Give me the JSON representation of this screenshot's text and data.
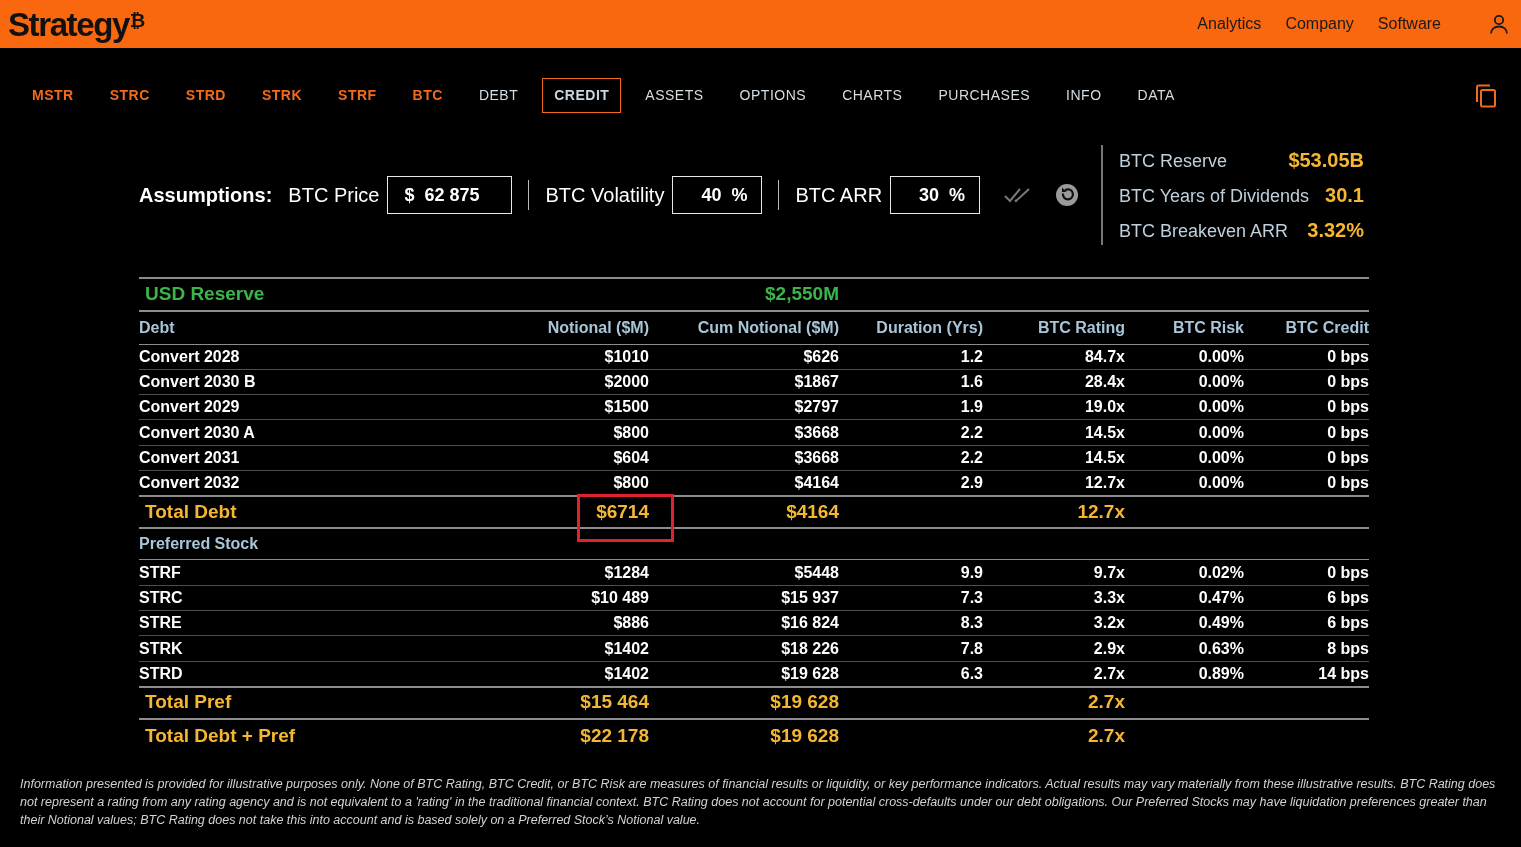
{
  "header": {
    "logo": "Strategy",
    "logo_mark": "₿",
    "links": [
      "Analytics",
      "Company",
      "Software"
    ]
  },
  "tabs": [
    {
      "label": "MSTR",
      "kind": "ticker",
      "selected": false
    },
    {
      "label": "STRC",
      "kind": "ticker",
      "selected": false
    },
    {
      "label": "STRD",
      "kind": "ticker",
      "selected": false
    },
    {
      "label": "STRK",
      "kind": "ticker",
      "selected": false
    },
    {
      "label": "STRF",
      "kind": "ticker",
      "selected": false
    },
    {
      "label": "BTC",
      "kind": "ticker",
      "selected": false
    },
    {
      "label": "DEBT",
      "kind": "page",
      "selected": false
    },
    {
      "label": "CREDIT",
      "kind": "page",
      "selected": true
    },
    {
      "label": "ASSETS",
      "kind": "page",
      "selected": false
    },
    {
      "label": "OPTIONS",
      "kind": "page",
      "selected": false
    },
    {
      "label": "CHARTS",
      "kind": "page",
      "selected": false
    },
    {
      "label": "PURCHASES",
      "kind": "page",
      "selected": false
    },
    {
      "label": "INFO",
      "kind": "page",
      "selected": false
    },
    {
      "label": "DATA",
      "kind": "page",
      "selected": false
    }
  ],
  "assumptions": {
    "title": "Assumptions:",
    "inputs": [
      {
        "label": "BTC Price",
        "prefix": "$",
        "value": "62 875"
      },
      {
        "label": "BTC Volatility",
        "value": "40",
        "suffix": "%"
      },
      {
        "label": "BTC ARR",
        "value": "30",
        "suffix": "%"
      }
    ]
  },
  "metrics": [
    {
      "label": "BTC Reserve",
      "value": "$53.05B"
    },
    {
      "label": "BTC Years of Dividends",
      "value": "30.1"
    },
    {
      "label": "BTC Breakeven ARR",
      "value": "3.32%"
    }
  ],
  "table": {
    "reserve": {
      "label": "USD Reserve",
      "cum_notional": "$2,550M"
    },
    "columns": [
      "Debt",
      "Notional ($M)",
      "Cum Notional ($M)",
      "Duration (Yrs)",
      "BTC Rating",
      "BTC Risk",
      "BTC Credit"
    ],
    "rows": [
      {
        "kind": "item",
        "cells": [
          "Convert 2028",
          "$1010",
          "$626",
          "1.2",
          "84.7x",
          "0.00%",
          "0 bps"
        ]
      },
      {
        "kind": "item",
        "cells": [
          "Convert 2030 B",
          "$2000",
          "$1867",
          "1.6",
          "28.4x",
          "0.00%",
          "0 bps"
        ]
      },
      {
        "kind": "item",
        "cells": [
          "Convert 2029",
          "$1500",
          "$2797",
          "1.9",
          "19.0x",
          "0.00%",
          "0 bps"
        ]
      },
      {
        "kind": "item",
        "cells": [
          "Convert 2030 A",
          "$800",
          "$3668",
          "2.2",
          "14.5x",
          "0.00%",
          "0 bps"
        ]
      },
      {
        "kind": "item",
        "cells": [
          "Convert 2031",
          "$604",
          "$3668",
          "2.2",
          "14.5x",
          "0.00%",
          "0 bps"
        ]
      },
      {
        "kind": "item",
        "cells": [
          "Convert 2032",
          "$800",
          "$4164",
          "2.9",
          "12.7x",
          "0.00%",
          "0 bps"
        ]
      },
      {
        "kind": "total",
        "label": "Total Debt",
        "notional": "$6714",
        "cum_notional": "$4164",
        "rating": "12.7x",
        "highlighted": true
      },
      {
        "kind": "section",
        "label": "Preferred Stock"
      },
      {
        "kind": "item",
        "cells": [
          "STRF",
          "$1284",
          "$5448",
          "9.9",
          "9.7x",
          "0.02%",
          "0 bps"
        ]
      },
      {
        "kind": "item",
        "cells": [
          "STRC",
          "$10 489",
          "$15 937",
          "7.3",
          "3.3x",
          "0.47%",
          "6 bps"
        ]
      },
      {
        "kind": "item",
        "cells": [
          "STRE",
          "$886",
          "$16 824",
          "8.3",
          "3.2x",
          "0.49%",
          "6 bps"
        ]
      },
      {
        "kind": "item",
        "cells": [
          "STRK",
          "$1402",
          "$18 226",
          "7.8",
          "2.9x",
          "0.63%",
          "8 bps"
        ]
      },
      {
        "kind": "item",
        "cells": [
          "STRD",
          "$1402",
          "$19 628",
          "6.3",
          "2.7x",
          "0.89%",
          "14 bps"
        ]
      },
      {
        "kind": "total",
        "label": "Total Pref",
        "notional": "$15 464",
        "cum_notional": "$19 628",
        "rating": "2.7x",
        "highlighted": false
      },
      {
        "kind": "total",
        "label": "Total Debt + Pref",
        "notional": "$22 178",
        "cum_notional": "$19 628",
        "rating": "2.7x",
        "highlighted": false
      }
    ]
  },
  "disclaimer": "Information presented is provided for illustrative purposes only. None of BTC Rating, BTC Credit, or BTC Risk are measures of financial results or liquidity, or key performance indicators. Actual results may vary materially from these illustrative results. BTC Rating does not represent a rating from any rating agency and is not equivalent to a 'rating' in the traditional financial context. BTC Rating does not account for potential cross-defaults under our debt obligations. Our Preferred Stocks may have liquidation preferences greater than their Notional values; BTC Rating does not take this into account and is based solely on a Preferred Stock’s Notional value."
}
